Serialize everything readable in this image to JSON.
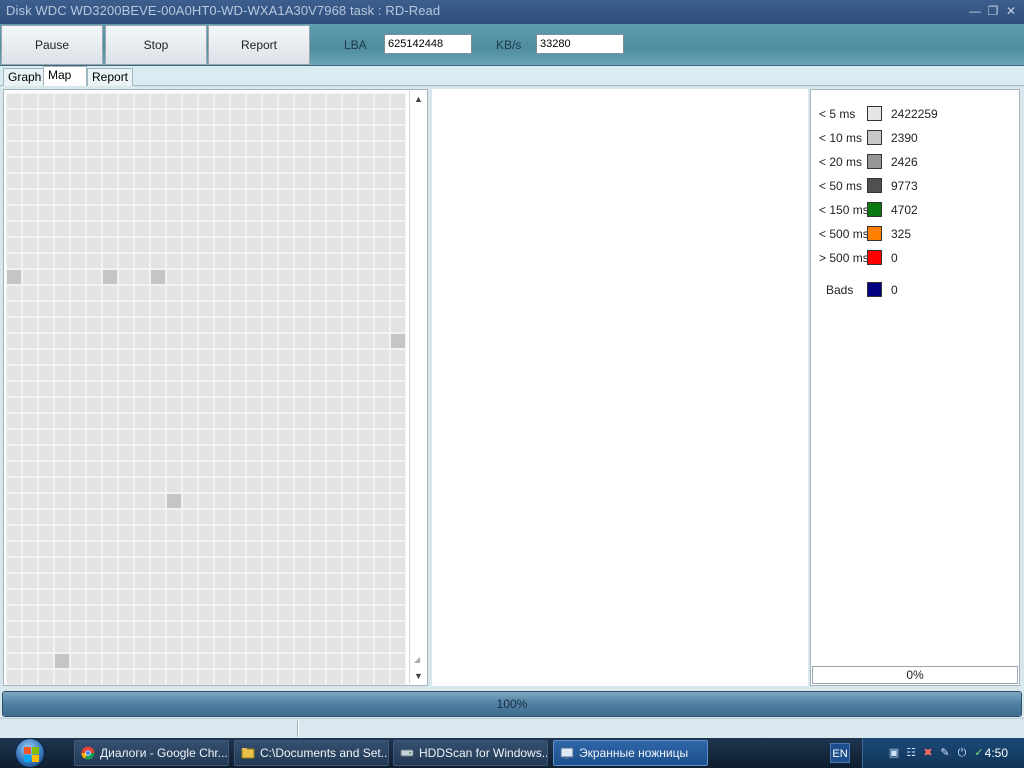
{
  "window": {
    "title": "Disk WDC WD3200BEVE-00A0HT0-WD-WXA1A30V7968   task : RD-Read",
    "controls": [
      "minimize-icon",
      "restore-icon",
      "close-icon"
    ]
  },
  "toolbar": {
    "pause_label": "Pause",
    "stop_label": "Stop",
    "report_label": "Report",
    "lba_label": "LBA",
    "lba_value": "625142448",
    "kbs_label": "KB/s",
    "kbs_value": "33280"
  },
  "tabs": [
    {
      "label": "Graph",
      "active": false
    },
    {
      "label": "Map",
      "active": true
    },
    {
      "label": "Report",
      "active": false
    }
  ],
  "legend": {
    "rows": [
      {
        "label": "< 5 ms",
        "color": "#e6e6e6",
        "value": "2422259"
      },
      {
        "label": "< 10 ms",
        "color": "#c8c8c8",
        "value": "2390"
      },
      {
        "label": "< 20 ms",
        "color": "#969696",
        "value": "2426"
      },
      {
        "label": "< 50 ms",
        "color": "#505050",
        "value": "9773"
      },
      {
        "label": "< 150 ms",
        "color": "#0a7a10",
        "value": "4702"
      },
      {
        "label": "< 500 ms",
        "color": "#ff8000",
        "value": "325"
      },
      {
        "label": "> 500 ms",
        "color": "#ff0000",
        "value": "0"
      },
      {
        "label": "Bads",
        "color": "#000080",
        "value": "0"
      }
    ],
    "percent": "0%"
  },
  "progress": {
    "text": "100%",
    "fraction": 1.0
  },
  "taskbar": {
    "items": [
      {
        "label": "Диалоги - Google Chr...",
        "icon": "chrome-icon",
        "active": false
      },
      {
        "label": "C:\\Documents and Set...",
        "icon": "folder-icon",
        "active": false
      },
      {
        "label": "HDDScan for Windows...",
        "icon": "disk-icon",
        "active": false
      },
      {
        "label": "Экранные ножницы",
        "icon": "snipping-tool-icon",
        "active": true
      }
    ],
    "language": "EN",
    "clock": "4:50",
    "tray_icons": [
      "network-icon",
      "wifi-icon",
      "volume-muted-icon",
      "pen-icon",
      "power-icon",
      "safely-remove-icon"
    ]
  },
  "map": {
    "columns": 25,
    "rows": 37,
    "highlighted_cells": [
      [
        0,
        11
      ],
      [
        6,
        11
      ],
      [
        9,
        11
      ],
      [
        24,
        15
      ],
      [
        10,
        25
      ],
      [
        3,
        35
      ]
    ]
  }
}
